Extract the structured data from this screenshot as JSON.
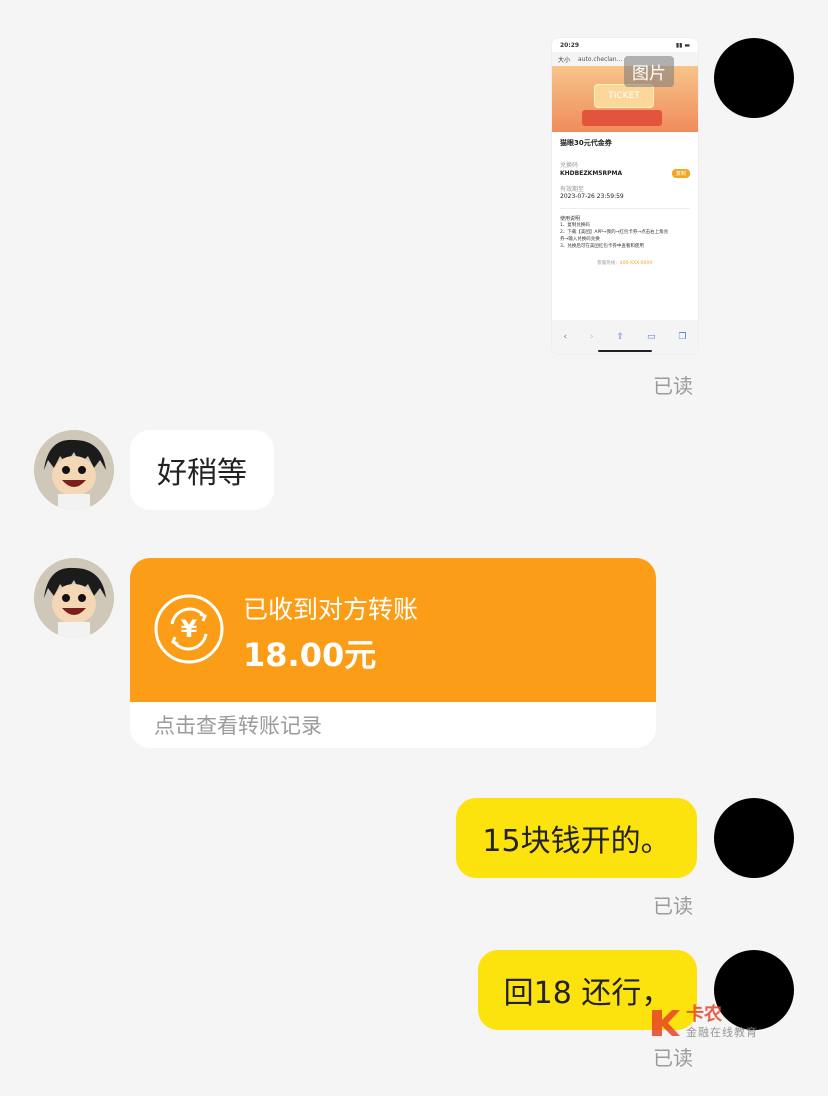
{
  "messages": {
    "image_message": {
      "image_label": "图片",
      "read_status": "已读",
      "screenshot": {
        "status_time": "20:29",
        "tab_label": "大小",
        "url": "auto.checlan...",
        "banner_text": "TICKET",
        "coupon_title": "猫眼30元代金券",
        "code_label": "兑换码",
        "code_value": "KHDBEZKM5RPMA",
        "copy_button": "复制",
        "expiry_label": "有效期至",
        "expiry_value": "2023-07-26 23:59:59",
        "usage_title": "使用说明",
        "usage_lines": [
          "1、复制兑换码",
          "2、下载【美团】APP→我的→红包卡券→点击右上角兑",
          "券→输入兑换码兑换",
          "3、兑换后可在美团红包卡券中查看和使用"
        ],
        "hotline_label": "客服热线：",
        "hotline_value": "400-XXX-XXXX"
      }
    },
    "text_reply": {
      "text": "好稍等"
    },
    "transfer": {
      "title": "已收到对方转账",
      "amount": "18.00元",
      "icon_glyph": "¥",
      "footer": "点击查看转账记录"
    },
    "my_message_1": {
      "text": "15块钱开的。",
      "read_status": "已读"
    },
    "my_message_2": {
      "text": "回18 还行，",
      "read_status": "已读"
    }
  },
  "watermark": {
    "logo_text": "卡农",
    "sub_text": "金融在线教育"
  },
  "colors": {
    "background": "#f5f5f5",
    "my_bubble": "#fde30d",
    "transfer_orange": "#fb9d16",
    "read_gray": "#9b9b9b"
  }
}
